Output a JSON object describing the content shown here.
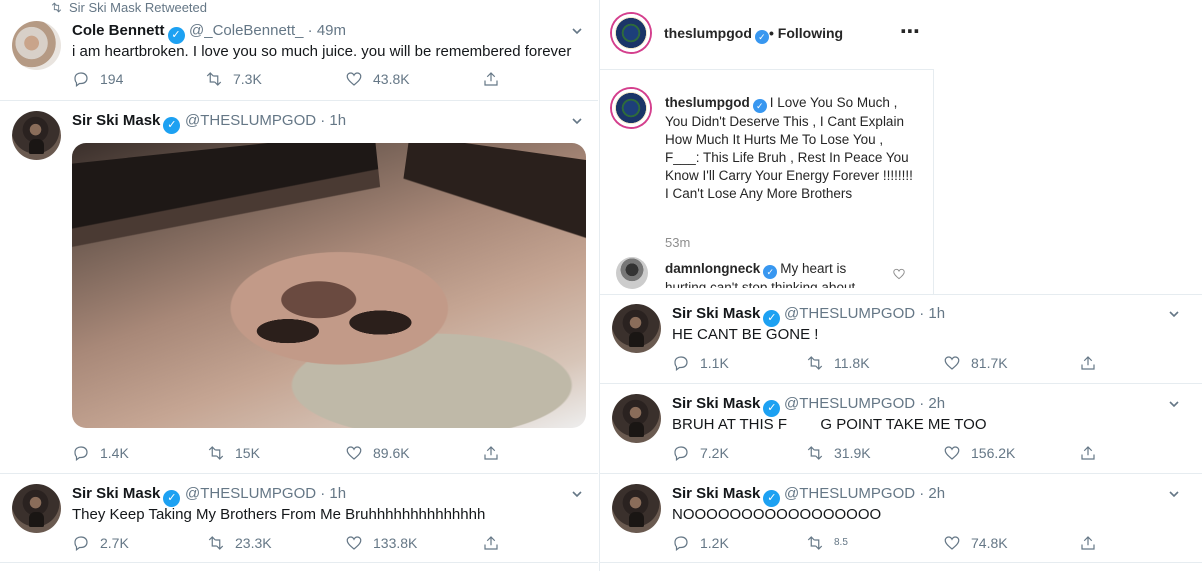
{
  "left_column": {
    "retweet_banner": "Sir Ski Mask Retweeted",
    "tweets": [
      {
        "name": "Cole Bennett",
        "handle": "@_ColeBennett_",
        "time": "· 49m",
        "text": "i am heartbroken. I love you so much juice. you will be remembered forever",
        "replies": "194",
        "retweets": "7.3K",
        "likes": "43.8K"
      },
      {
        "name": "Sir Ski Mask",
        "handle": "@THESLUMPGOD",
        "time": "· 1h",
        "text": "",
        "replies": "1.4K",
        "retweets": "15K",
        "likes": "89.6K"
      },
      {
        "name": "Sir Ski Mask",
        "handle": "@THESLUMPGOD",
        "time": "· 1h",
        "text": "They Keep Taking My Brothers From Me Bruhhhhhhhhhhhhhh",
        "replies": "2.7K",
        "retweets": "23.3K",
        "likes": "133.8K"
      }
    ]
  },
  "instagram": {
    "header_name": "theslumpgod",
    "following": "• Following",
    "caption_name": "theslumpgod",
    "caption": "I Love You So Much , You Didn't Deserve This , I Cant Explain How Much It Hurts Me To Lose You , F___: This Life Bruh , Rest In Peace You Know I'll Carry Your Energy Forever !!!!!!!! I Can't Lose Any More Brothers",
    "time": "53m",
    "comment_name": "damnlongneck",
    "comment_text": "My heart is hurting can't stop thinking about"
  },
  "right_column": {
    "tweets": [
      {
        "name": "Sir Ski Mask",
        "handle": "@THESLUMPGOD",
        "time": "· 1h",
        "text": "HE CANT BE GONE !",
        "replies": "1.1K",
        "retweets": "11.8K",
        "likes": "81.7K"
      },
      {
        "name": "Sir Ski Mask",
        "handle": "@THESLUMPGOD",
        "time": "· 2h",
        "text": "BRUH AT THIS F        G POINT TAKE ME TOO",
        "replies": "7.2K",
        "retweets": "31.9K",
        "likes": "156.2K"
      },
      {
        "name": "Sir Ski Mask",
        "handle": "@THESLUMPGOD",
        "time": "· 2h",
        "text": "NOOOOOOOOOOOOOOOOO",
        "replies": "1.2K",
        "retweets": "8.5",
        "likes": "74.8K"
      }
    ]
  },
  "icons": [
    "reply-icon",
    "retweet-icon",
    "like-icon",
    "share-icon",
    "chevron-down-icon",
    "verified-icon",
    "more-icon"
  ],
  "colors": {
    "twitter_blue": "#1da1f2",
    "muted": "#657786",
    "ig_ring": "#d43f8d"
  }
}
